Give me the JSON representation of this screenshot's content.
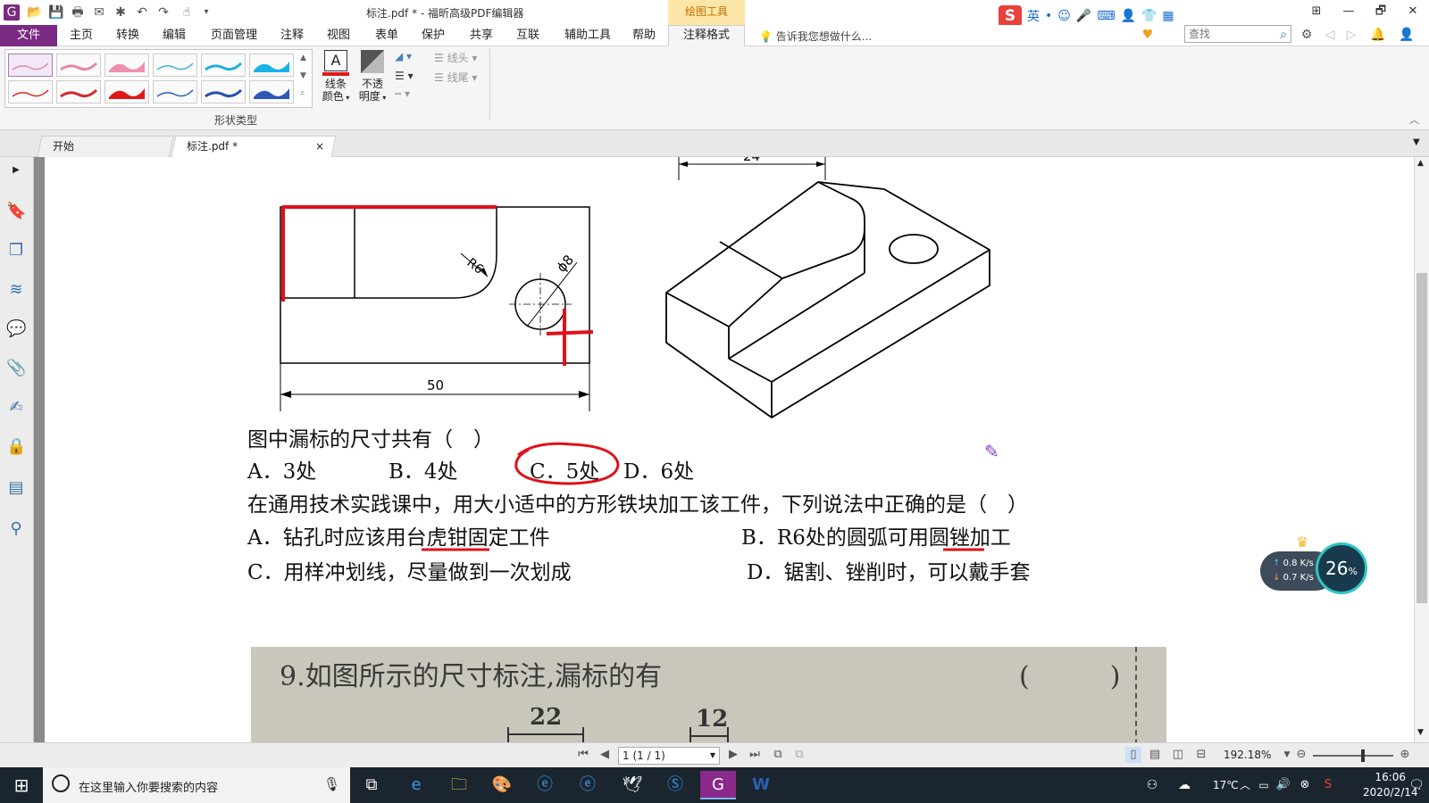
{
  "window": {
    "title": "标注.pdf * - 福昕高级PDF编辑器",
    "context_tab": "绘图工具",
    "controls": [
      "⊞",
      "—",
      "🗗",
      "✕"
    ]
  },
  "ime": {
    "lang": "英",
    "items": [
      "•",
      "☺",
      "🎤",
      "⌨",
      "👤",
      "👕",
      "▦"
    ]
  },
  "menu": {
    "file": "文件",
    "items": [
      "主页",
      "转换",
      "编辑",
      "页面管理",
      "注释",
      "视图",
      "表单",
      "保护",
      "共享",
      "互联",
      "辅助工具",
      "帮助"
    ],
    "active": "注释格式",
    "tell_me": "告诉我您想做什么...",
    "search_placeholder": "查找"
  },
  "ribbon": {
    "shape_group_label": "形状类型",
    "line_color": [
      "线条",
      "颜色"
    ],
    "opacity": [
      "不透",
      "明度"
    ],
    "line_head": "线头",
    "line_tail": "线尾"
  },
  "tabs": [
    {
      "label": "开始"
    },
    {
      "label": "标注.pdf *",
      "close": "×"
    }
  ],
  "drawing": {
    "dim_24": "24",
    "dim_r6": "R6",
    "dim_phi8": "ϕ8",
    "dim_50": "50"
  },
  "question1": {
    "stem": "图中漏标的尺寸共有（　）",
    "options": [
      "A．3处",
      "B．4处",
      "C．5处",
      "D．6处"
    ]
  },
  "question2": {
    "stem": "在通用技术实践课中，用大小适中的方形铁块加工该工件，下列说法中正确的是（　）",
    "options": [
      "A．钻孔时应该用台虎钳固定工件",
      "B．R6处的圆弧可用圆锉加工",
      "C．用样冲划线，尽量做到一次划成",
      "D．锯割、锉削时，可以戴手套"
    ]
  },
  "photo": {
    "question": "9.如图所示的尺寸标注,漏标的有",
    "paren": "(　　　)",
    "dim_22": "22",
    "dim_12": "12"
  },
  "net": {
    "up": "0.8 K/s",
    "down": "0.7 K/s",
    "percent": "26",
    "unit": "%"
  },
  "status": {
    "page": "1 (1 / 1)",
    "zoom": "192.18%"
  },
  "taskbar": {
    "search": "在这里输入你要搜索的内容",
    "temp": "17℃",
    "time": "16:06",
    "date": "2020/2/14"
  },
  "colors": {
    "accent": "#7a2a82",
    "annot_red": "#e0101a"
  }
}
